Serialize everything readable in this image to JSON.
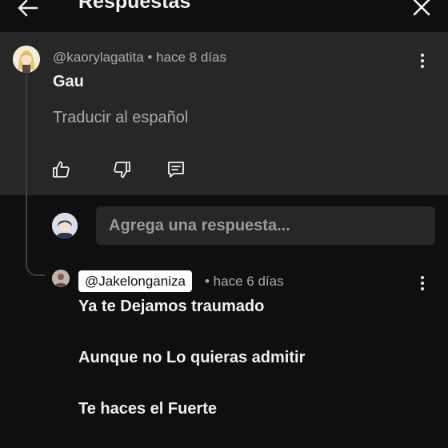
{
  "header": {
    "title": "Respuestas"
  },
  "parent_comment": {
    "author": "@kaorylagatita",
    "time": "• hace 8 días",
    "text": "Gau",
    "translate_label": "Traducir al español"
  },
  "reply_box": {
    "placeholder": "Agrega una respuesta..."
  },
  "reply": {
    "mention": "@Jakelonganiza",
    "time": "• hace 6 días",
    "lines": [
      "Ya te Dejamos traumado",
      "Aunque no Lo quieras admitir",
      "Te haces el Fuerte"
    ]
  },
  "colors": {
    "background": "#0f0f0f",
    "parent_bg": "#272727",
    "text": "#f1f1f1",
    "muted": "#aaaaaa"
  },
  "icons": [
    "back-arrow-icon",
    "close-icon",
    "like-icon",
    "dislike-icon",
    "reply-icon",
    "more-vert-icon"
  ]
}
